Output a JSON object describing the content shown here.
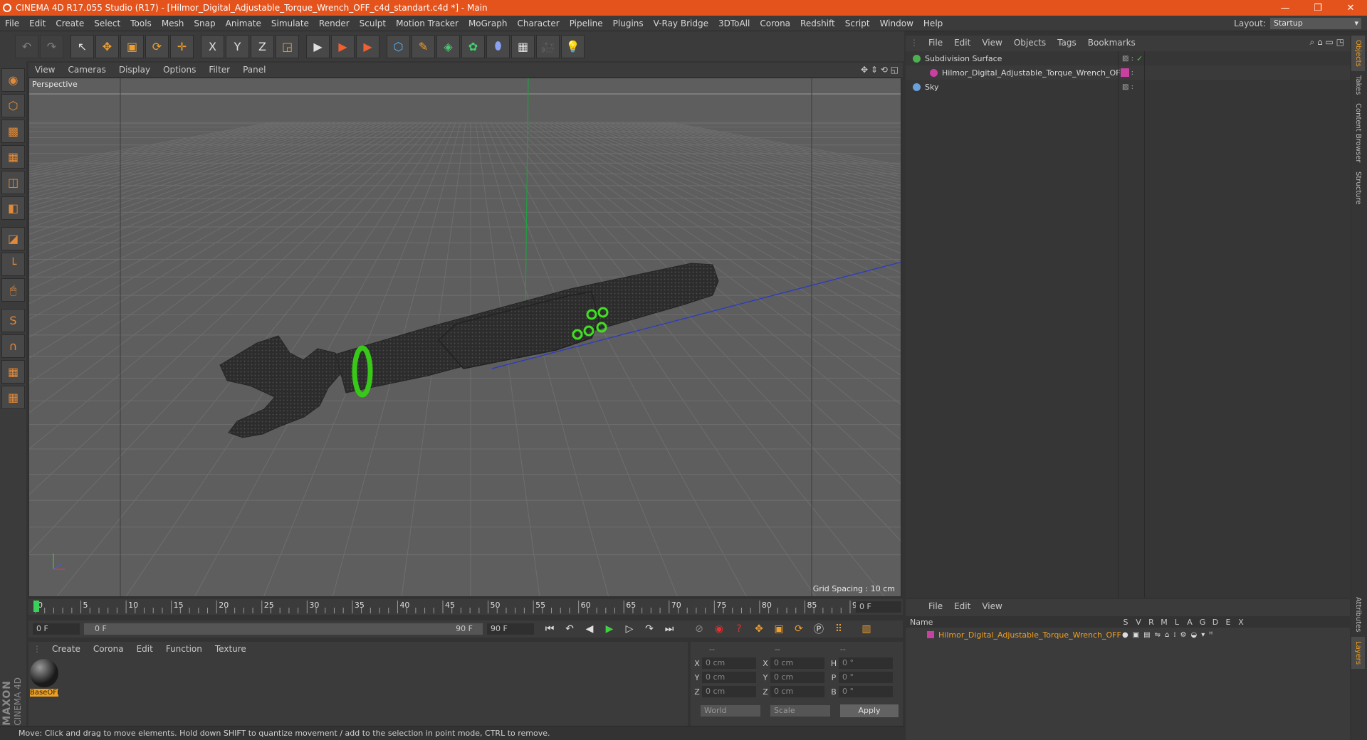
{
  "window": {
    "title": "CINEMA 4D R17.055 Studio (R17) - [Hilmor_Digital_Adjustable_Torque_Wrench_OFF_c4d_standart.c4d *] - Main",
    "min": "—",
    "max": "❐",
    "close": "✕"
  },
  "menu": [
    "File",
    "Edit",
    "Create",
    "Select",
    "Tools",
    "Mesh",
    "Snap",
    "Animate",
    "Simulate",
    "Render",
    "Sculpt",
    "Motion Tracker",
    "MoGraph",
    "Character",
    "Pipeline",
    "Plugins",
    "V-Ray Bridge",
    "3DToAll",
    "Corona",
    "Redshift",
    "Script",
    "Window",
    "Help"
  ],
  "layout": {
    "label": "Layout:",
    "value": "Startup"
  },
  "toolbar": {
    "undo": "↶",
    "redo": "↷",
    "select": "↖",
    "move": "✥",
    "scale": "▣",
    "rotate": "⟳",
    "cross": "✛",
    "x": "X",
    "y": "Y",
    "z": "Z",
    "coord": "◲",
    "render1": "▶",
    "render2": "▶",
    "render3": "▶",
    "cube": "⬡",
    "pen": "✎",
    "subdiv": "◈",
    "array": "✿",
    "deform": "⬮",
    "floor": "▦",
    "camera": "🎥",
    "light": "💡"
  },
  "lefttools": [
    "◉",
    "⬡",
    "▩",
    "▦",
    "◫",
    "◧",
    "◪",
    "└",
    "🖱",
    "S",
    "∩",
    "▦",
    "▦"
  ],
  "viewport": {
    "menu": [
      "View",
      "Cameras",
      "Display",
      "Options",
      "Filter",
      "Panel"
    ],
    "label": "Perspective",
    "grid_spacing": "Grid Spacing : 10 cm",
    "nav": "✥ ⇕ ⟲ ◱"
  },
  "timeline": {
    "ticks": [
      "0",
      "5",
      "10",
      "15",
      "20",
      "25",
      "30",
      "35",
      "40",
      "45",
      "50",
      "55",
      "60",
      "65",
      "70",
      "75",
      "80",
      "85",
      "90"
    ],
    "frame_display": "0 F"
  },
  "controls": {
    "start": "0 F",
    "range_start": "0 F",
    "range_end": "90 F",
    "end": "90 F"
  },
  "materials": {
    "menu": [
      "Create",
      "Corona",
      "Edit",
      "Function",
      "Texture"
    ],
    "items": [
      {
        "name": "BaseOFI"
      }
    ]
  },
  "coords": {
    "head": [
      "--",
      "--",
      "--"
    ],
    "rows": [
      {
        "a": "X",
        "av": "0 cm",
        "b": "X",
        "bv": "0 cm",
        "c": "H",
        "cv": "0 °"
      },
      {
        "a": "Y",
        "av": "0 cm",
        "b": "Y",
        "bv": "0 cm",
        "c": "P",
        "cv": "0 °"
      },
      {
        "a": "Z",
        "av": "0 cm",
        "b": "Z",
        "bv": "0 cm",
        "c": "B",
        "cv": "0 °"
      }
    ],
    "world": "World",
    "scale": "Scale",
    "apply": "Apply"
  },
  "status": "Move: Click and drag to move elements. Hold down SHIFT to quantize movement / add to the selection in point mode, CTRL to remove.",
  "objects": {
    "menu": [
      "File",
      "Edit",
      "View",
      "Objects",
      "Tags",
      "Bookmarks"
    ],
    "items": [
      {
        "name": "Subdivision Surface",
        "color": "#4caf50"
      },
      {
        "name": "Hilmor_Digital_Adjustable_Torque_Wrench_OFF",
        "color": "#c840a0"
      },
      {
        "name": "Sky",
        "color": "#6aa0d8"
      }
    ]
  },
  "layers": {
    "menu": [
      "File",
      "Edit",
      "View"
    ],
    "cols": [
      "Name",
      "S",
      "V",
      "R",
      "M",
      "L",
      "A",
      "G",
      "D",
      "E",
      "X"
    ],
    "row": "Hilmor_Digital_Adjustable_Torque_Wrench_OFF"
  },
  "vtabs": [
    "Objects",
    "Takes",
    "Content Browser",
    "Structure",
    "Attributes",
    "Layers"
  ],
  "brand": {
    "maxon": "MAXON",
    "c4d": "CINEMA 4D"
  }
}
